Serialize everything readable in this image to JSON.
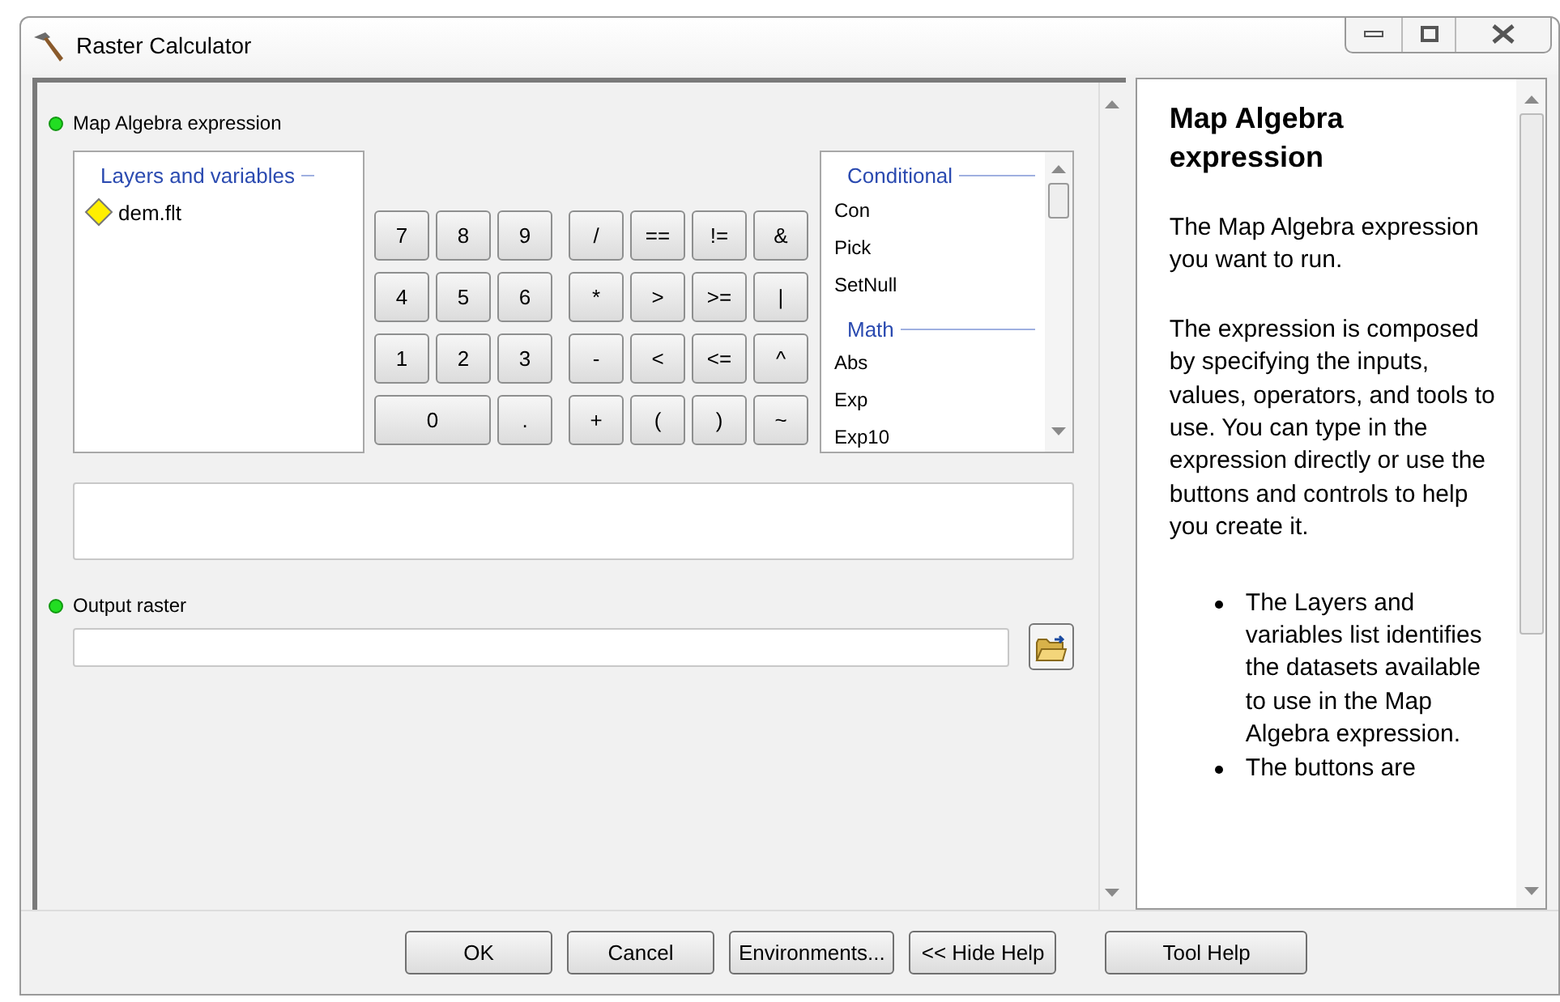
{
  "window": {
    "title": "Raster Calculator"
  },
  "expression": {
    "label": "Map Algebra expression",
    "required": true
  },
  "layers": {
    "heading": "Layers and variables",
    "items": [
      {
        "name": "dem.flt"
      }
    ]
  },
  "digit_keys": [
    {
      "label": "7",
      "kind": "normal"
    },
    {
      "label": "8",
      "kind": "normal"
    },
    {
      "label": "9",
      "kind": "normal"
    },
    {
      "label": "4",
      "kind": "normal"
    },
    {
      "label": "5",
      "kind": "normal"
    },
    {
      "label": "6",
      "kind": "normal"
    },
    {
      "label": "1",
      "kind": "normal"
    },
    {
      "label": "2",
      "kind": "normal"
    },
    {
      "label": "3",
      "kind": "normal"
    },
    {
      "label": "0",
      "kind": "wide"
    },
    {
      "label": ".",
      "kind": "normal"
    }
  ],
  "operator_keys": [
    "/",
    "==",
    "!=",
    "&",
    "*",
    ">",
    ">=",
    "|",
    "-",
    "<",
    "<=",
    "^",
    "+",
    "(",
    ")",
    "~"
  ],
  "functions": [
    {
      "heading": "Conditional",
      "items": [
        "Con",
        "Pick",
        "SetNull"
      ]
    },
    {
      "heading": "Math",
      "items": [
        "Abs",
        "Exp",
        "Exp10"
      ]
    }
  ],
  "output": {
    "label": "Output raster",
    "required": true
  },
  "help": {
    "title": "Map Algebra expression",
    "paragraphs": [
      "The Map Algebra expression you want to run.",
      "The expression is composed by specifying the inputs, values, operators, and tools to use. You can type in the expression directly or use the buttons and controls to help you create it."
    ],
    "bullets": [
      "The Layers and variables list identifies the datasets available to use in the Map Algebra expression.",
      "The buttons are"
    ]
  },
  "buttons": [
    "OK",
    "Cancel",
    "Environments...",
    "<< Hide Help"
  ],
  "help_button": "Tool Help"
}
